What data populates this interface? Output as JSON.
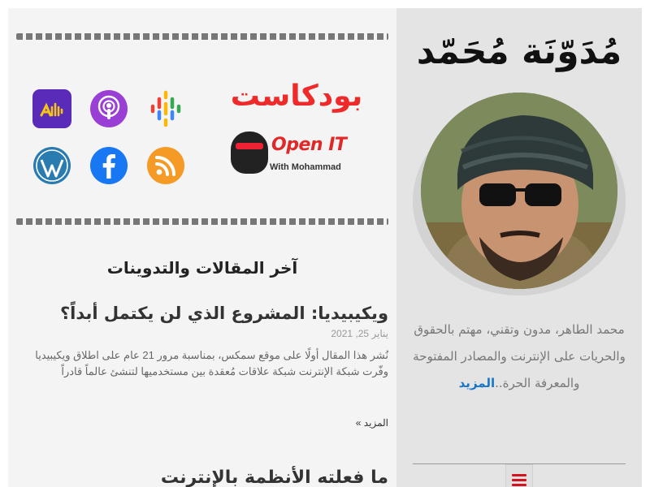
{
  "podcast": {
    "title": "بودكاست",
    "logo_name": "Open IT",
    "logo_sub": "With Mohammad",
    "icons": [
      "anchor-icon",
      "apple-podcasts-icon",
      "google-podcasts-icon",
      "wordpress-icon",
      "facebook-icon",
      "rss-icon"
    ]
  },
  "main": {
    "heading": "آخر المقالات والتدوينات",
    "posts": [
      {
        "title": "ويكيبيديا: المشروع الذي لن يكتمل أبداً؟",
        "date": "يناير 25, 2021",
        "excerpt": "نُشر هذا المقال أولًا على موقع سمكس، بمناسبة مرور 21 عام على اطلاق ويكيبيديا وفّرت شبكة الإنترنت شبكة علاقات مُعقدة بين مستخدميها لتنشئ عالماً قادراً",
        "read_more": "المزيد »"
      },
      {
        "title": "ما فعلته الأنظمة بالإنترنت"
      }
    ]
  },
  "sidebar": {
    "site_logo": "مُدَوّنَة مُحَمّد",
    "bio": "محمد الطاهر، مدون وتقني، مهتم بالحقوق والحريات على الإنترنت والمصادر المفتوحة والمعرفة الحرة..",
    "bio_more": "المزيد"
  },
  "colors": {
    "accent_red": "#ee2a2a",
    "link_blue": "#1676c8",
    "sidebar_bg": "#e4e4e4",
    "main_bg": "#f4f4f4"
  }
}
